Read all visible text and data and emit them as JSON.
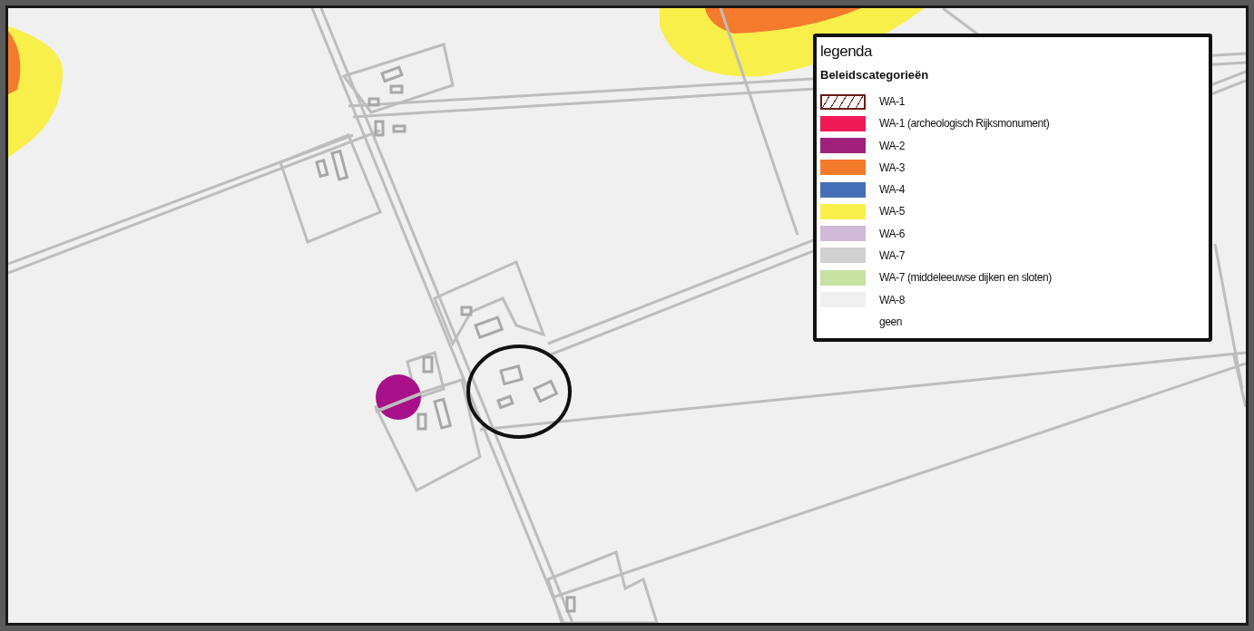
{
  "legend": {
    "title": "legenda",
    "subtitle": "Beleidscategorieën",
    "items": [
      {
        "label": "WA-1",
        "kind": "hatch",
        "color": "#6b1a1a"
      },
      {
        "label": "WA-1 (archeologisch Rijksmonument)",
        "kind": "fill",
        "color": "#f01a56"
      },
      {
        "label": "WA-2",
        "kind": "fill",
        "color": "#a0207c"
      },
      {
        "label": "WA-3",
        "kind": "fill",
        "color": "#f47a2c"
      },
      {
        "label": "WA-4",
        "kind": "fill",
        "color": "#4570b8"
      },
      {
        "label": "WA-5",
        "kind": "fill",
        "color": "#f9ef4a"
      },
      {
        "label": "WA-6",
        "kind": "fill",
        "color": "#d1b9d8"
      },
      {
        "label": "WA-7",
        "kind": "fill",
        "color": "#d0d0d0"
      },
      {
        "label": "WA-7 (middeleeuwse dijken en sloten)",
        "kind": "fill",
        "color": "#c7e1a3"
      },
      {
        "label": "WA-8",
        "kind": "fill",
        "color": "#f0f0f0"
      },
      {
        "label": "geen",
        "kind": "none"
      }
    ]
  }
}
